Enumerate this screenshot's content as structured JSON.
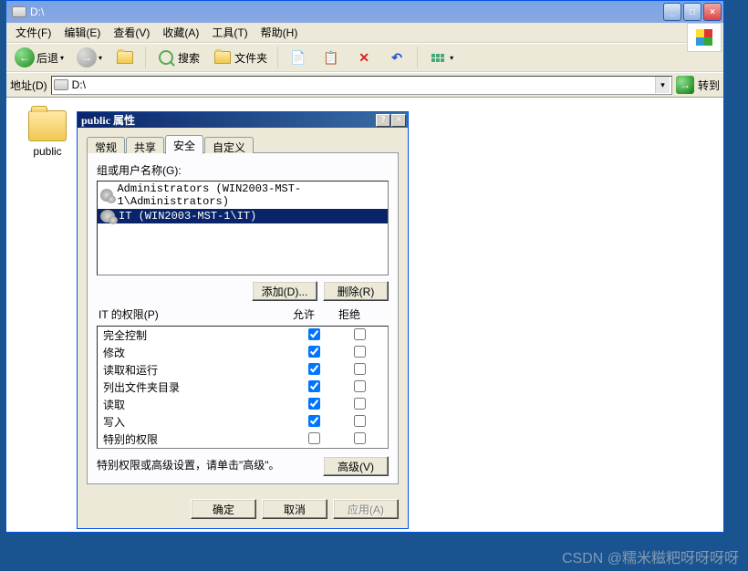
{
  "explorer": {
    "title": "D:\\",
    "menu": {
      "file": "文件(F)",
      "edit": "编辑(E)",
      "view": "查看(V)",
      "favorites": "收藏(A)",
      "tools": "工具(T)",
      "help": "帮助(H)"
    },
    "toolbar": {
      "back": "后退",
      "search": "搜索",
      "folders": "文件夹"
    },
    "address": {
      "label": "地址(D)",
      "value": "D:\\",
      "go": "转到"
    },
    "content": {
      "folder_name": "public"
    }
  },
  "dialog": {
    "title": "public 属性",
    "tabs": {
      "general": "常规",
      "sharing": "共享",
      "security": "安全",
      "custom": "自定义"
    },
    "security": {
      "group_or_user_label": "组或用户名称(G):",
      "users": [
        {
          "name": "Administrators (WIN2003-MST-1\\Administrators)",
          "selected": false
        },
        {
          "name": "IT (WIN2003-MST-1\\IT)",
          "selected": true
        }
      ],
      "add_btn": "添加(D)...",
      "remove_btn": "删除(R)",
      "perm_for_label": "IT 的权限(P)",
      "allow_label": "允许",
      "deny_label": "拒绝",
      "permissions": [
        {
          "name": "完全控制",
          "allow": true,
          "deny": false
        },
        {
          "name": "修改",
          "allow": true,
          "deny": false
        },
        {
          "name": "读取和运行",
          "allow": true,
          "deny": false
        },
        {
          "name": "列出文件夹目录",
          "allow": true,
          "deny": false
        },
        {
          "name": "读取",
          "allow": true,
          "deny": false
        },
        {
          "name": "写入",
          "allow": true,
          "deny": false
        },
        {
          "name": "特别的权限",
          "allow": false,
          "deny": false
        }
      ],
      "special_text": "特别权限或高级设置，请单击\"高级\"。",
      "advanced_btn": "高级(V)"
    },
    "buttons": {
      "ok": "确定",
      "cancel": "取消",
      "apply": "应用(A)"
    }
  },
  "watermark": "CSDN @糯米糍粑呀呀呀呀"
}
